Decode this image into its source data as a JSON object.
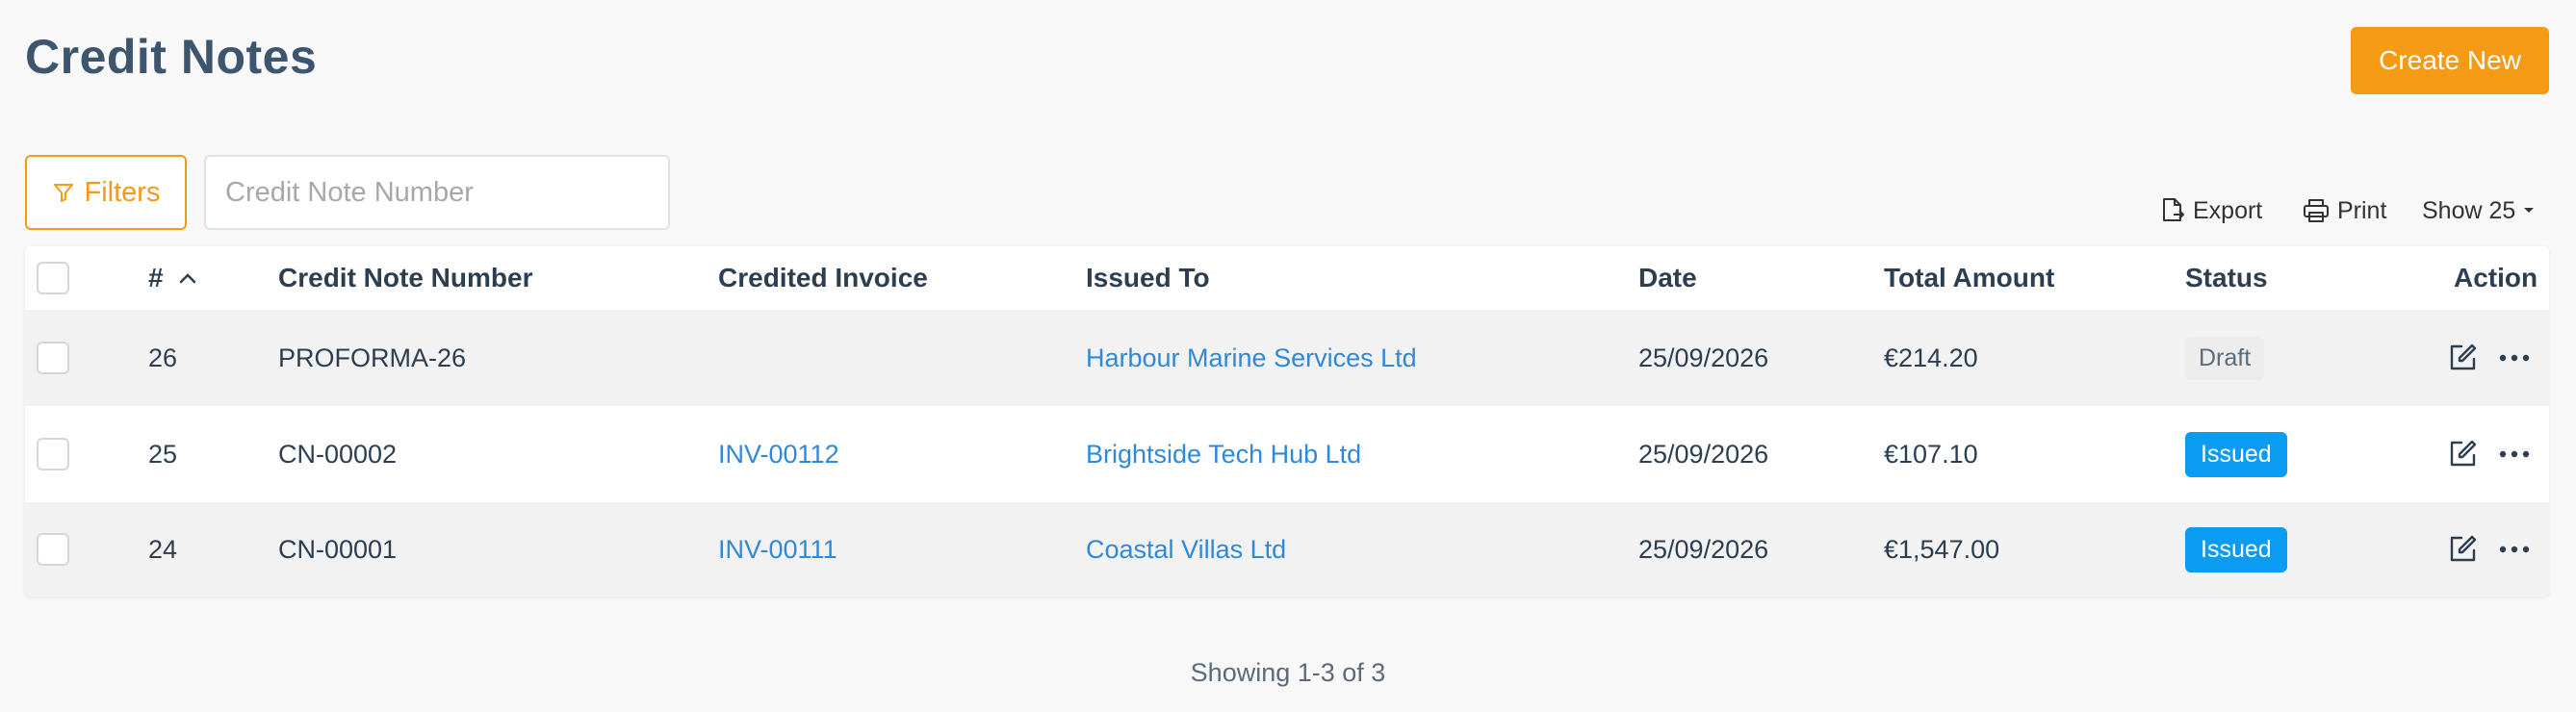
{
  "header": {
    "title": "Credit Notes",
    "create_label": "Create New"
  },
  "filters": {
    "button_label": "Filters",
    "search_placeholder": "Credit Note Number"
  },
  "toolbar": {
    "export_label": "Export",
    "print_label": "Print",
    "show_label": "Show 25"
  },
  "table": {
    "columns": [
      "#",
      "Credit Note Number",
      "Credited Invoice",
      "Issued To",
      "Date",
      "Total Amount",
      "Status",
      "Action"
    ],
    "rows": [
      {
        "num": "26",
        "credit_note": "PROFORMA-26",
        "invoice": "",
        "issued_to": "Harbour Marine Services Ltd",
        "date": "25/09/2026",
        "amount": "€214.20",
        "status": "Draft"
      },
      {
        "num": "25",
        "credit_note": "CN-00002",
        "invoice": "INV-00112",
        "issued_to": "Brightside Tech Hub Ltd",
        "date": "25/09/2026",
        "amount": "€107.10",
        "status": "Issued"
      },
      {
        "num": "24",
        "credit_note": "CN-00001",
        "invoice": "INV-00111",
        "issued_to": "Coastal Villas Ltd",
        "date": "25/09/2026",
        "amount": "€1,547.00",
        "status": "Issued"
      }
    ]
  },
  "footer": {
    "showing_text": "Showing 1-3 of 3"
  },
  "colors": {
    "accent": "#f59a14",
    "link": "#2f89d8",
    "issued_badge": "#0b9bf0",
    "title": "#3e5570"
  },
  "icons": [
    "filter-icon",
    "export-icon",
    "print-icon",
    "caret-down-icon",
    "sort-asc-icon",
    "edit-icon",
    "more-icon"
  ]
}
